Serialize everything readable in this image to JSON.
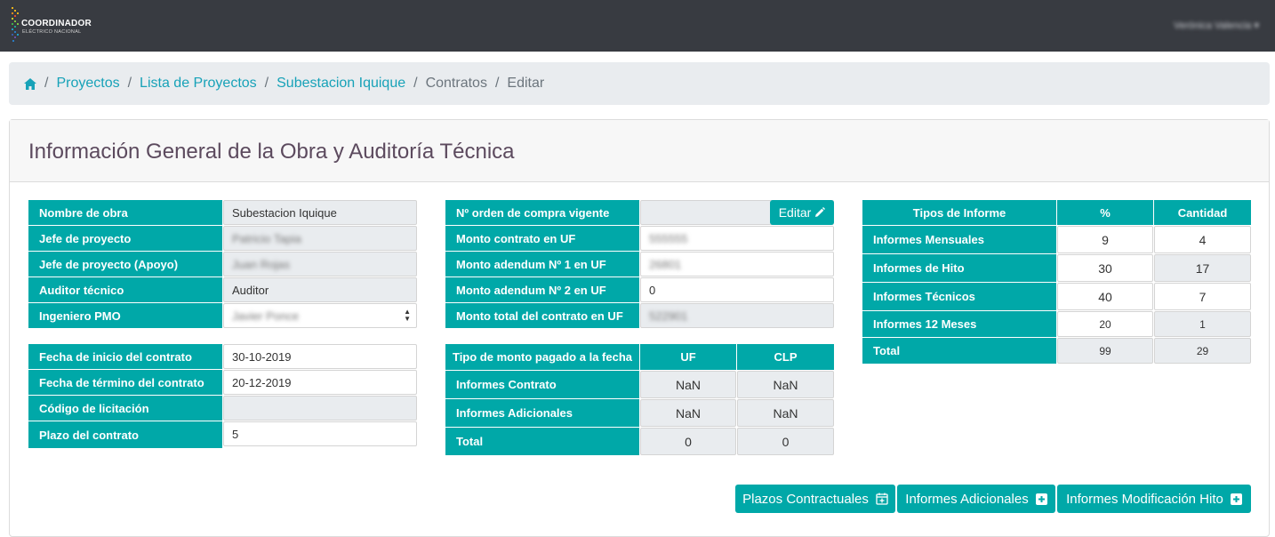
{
  "app": {
    "logo_line1": "COORDINADOR",
    "logo_line2": "ELÉCTRICO NACIONAL",
    "user_name": "Verónica Valencia"
  },
  "breadcrumb": {
    "items": [
      "Proyectos",
      "Lista de Proyectos",
      "Subestacion Iquique"
    ],
    "plain": [
      "Contratos",
      "Editar"
    ],
    "separator": "/"
  },
  "page": {
    "title": "Información General de la Obra y Auditoría Técnica"
  },
  "general": {
    "nombre_obra_label": "Nombre de obra",
    "nombre_obra_value": "Subestacion Iquique",
    "jefe_proyecto_label": "Jefe de proyecto",
    "jefe_proyecto_value": "Patricio Tapia",
    "jefe_apoyo_label": "Jefe de proyecto (Apoyo)",
    "jefe_apoyo_value": "Juan Rojas",
    "auditor_label": "Auditor técnico",
    "auditor_value": "Auditor",
    "pmo_label": "Ingeniero PMO",
    "pmo_value": "Javier Ponce"
  },
  "contrato": {
    "inicio_label": "Fecha de inicio del contrato",
    "inicio_value": "30-10-2019",
    "termino_label": "Fecha de término del contrato",
    "termino_value": "20-12-2019",
    "licitacion_label": "Código de licitación",
    "licitacion_value": "",
    "plazo_label": "Plazo del contrato",
    "plazo_value": "5"
  },
  "montos": {
    "orden_label": "Nº orden de compra vigente",
    "orden_value": "",
    "edit_button": "Editar",
    "contrato_uf_label": "Monto contrato en UF",
    "contrato_uf_value": "555555",
    "adendum1_label": "Monto adendum Nº 1 en UF",
    "adendum1_value": "26801",
    "adendum2_label": "Monto adendum Nº 2 en UF",
    "adendum2_value": "0",
    "total_label": "Monto total del contrato en UF",
    "total_value": "522901"
  },
  "pagado": {
    "header_label": "Tipo de monto pagado a la fecha",
    "col_uf": "UF",
    "col_clp": "CLP",
    "rows": [
      {
        "label": "Informes Contrato",
        "uf": "NaN",
        "clp": "NaN"
      },
      {
        "label": "Informes Adicionales",
        "uf": "NaN",
        "clp": "NaN"
      },
      {
        "label": "Total",
        "uf": "0",
        "clp": "0"
      }
    ]
  },
  "informes": {
    "col_tipo": "Tipos de Informe",
    "col_pct": "%",
    "col_cant": "Cantidad",
    "rows": [
      {
        "label": "Informes Mensuales",
        "pct": "9",
        "cant": "4"
      },
      {
        "label": "Informes de Hito",
        "pct": "30",
        "cant": "17"
      },
      {
        "label": "Informes Técnicos",
        "pct": "40",
        "cant": "7"
      },
      {
        "label": "Informes 12 Meses",
        "pct": "20",
        "cant": "1"
      },
      {
        "label": "Total",
        "pct": "99",
        "cant": "29"
      }
    ]
  },
  "actions": {
    "plazos": "Plazos Contractuales",
    "adicionales": "Informes Adicionales",
    "modificacion": "Informes Modificación Hito"
  },
  "colors": {
    "accent": "#00a8a8",
    "topbar": "#383b41",
    "link": "#17a2b8",
    "title": "#5c4a5e"
  }
}
